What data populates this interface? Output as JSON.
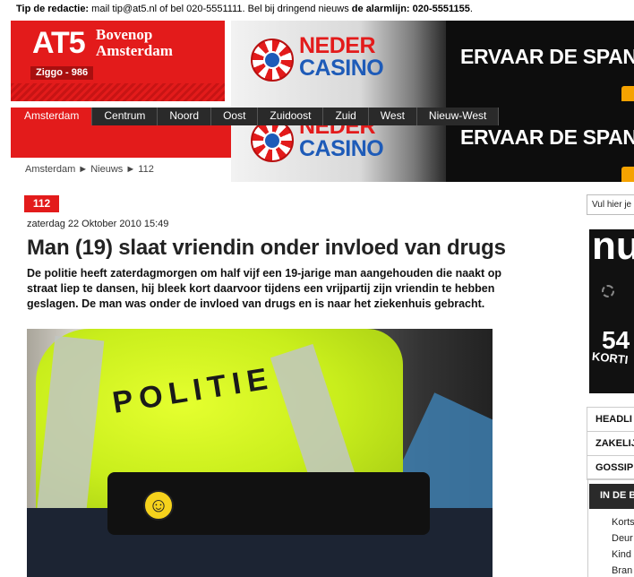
{
  "tipbar": {
    "label": "Tip de redactie:",
    "text1": " mail tip@at5.nl of bel 020-5551111. Bel bij dringend nieuws ",
    "alarm_label": "de alarmlijn: 020-5551155",
    "end": "."
  },
  "logo": {
    "at5": "AT5",
    "tagline": "Bovenop Amsterdam",
    "channel": "Ziggo - 986"
  },
  "banner": {
    "neder": "NEDER",
    "casino": "CASINO",
    "slogan": "ERVAAR DE SPANN"
  },
  "nav": {
    "items": [
      "Amsterdam",
      "Centrum",
      "Noord",
      "Oost",
      "Zuidoost",
      "Zuid",
      "West",
      "Nieuw-West"
    ]
  },
  "breadcrumb": "Amsterdam ► Nieuws ► 112",
  "article": {
    "category": "112",
    "date": "zaterdag 22 Oktober 2010 15:49",
    "headline": "Man (19) slaat vriendin onder invloed van drugs",
    "intro": "De politie heeft zaterdagmorgen om half vijf een 19-jarige man aangehouden die naakt op straat liep te dansen, hij bleek kort daarvoor tijdens een vrijpartij zijn vriendin te hebben geslagen. De man was onder de invloed van drugs en is naar het ziekenhuis gebracht.",
    "photo_text": "POLITIE"
  },
  "sidebar": {
    "search_text": "Vul hier je",
    "ad_brand": "nu",
    "ad_number": "54",
    "ad_kort": "KORTI",
    "tabs": [
      "HEADLI",
      "ZAKELIJ",
      "GOSSIP"
    ],
    "section_title": "IN DE B",
    "list": [
      "Korts",
      "Deur",
      "Kind",
      "Bran"
    ]
  },
  "colors": {
    "brand_red": "#e31b1b",
    "nav_dark": "#2a2a2a"
  }
}
